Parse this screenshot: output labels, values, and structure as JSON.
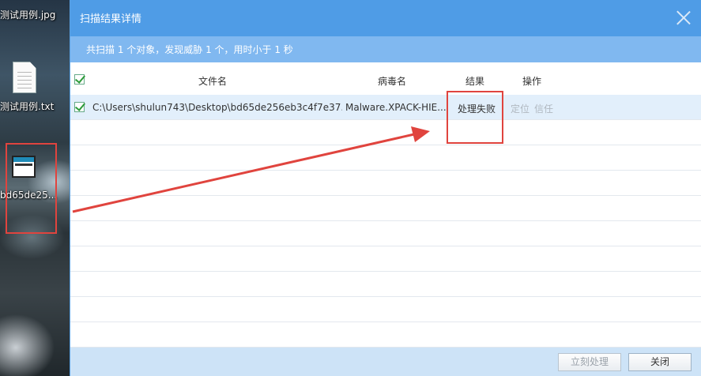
{
  "desktop": {
    "icons": [
      {
        "label": "测试用例.jpg"
      },
      {
        "label": "测试用例.txt"
      },
      {
        "label": "bd65de25..."
      }
    ]
  },
  "dialog": {
    "title": "扫描结果详情",
    "summary": "共扫描 1 个对象，发现威胁 1 个，用时小于 1 秒",
    "columns": {
      "filename": "文件名",
      "virus": "病毒名",
      "result": "结果",
      "action": "操作"
    },
    "rows": [
      {
        "checked": true,
        "filename": "C:\\Users\\shulun743\\Desktop\\bd65de256eb3c4f7e37...",
        "virus": "Malware.XPACK-HIE...",
        "result": "处理失败",
        "locate": "定位",
        "trust": "信任"
      }
    ],
    "buttons": {
      "process_now": "立刻处理",
      "close": "关闭"
    }
  },
  "annotation_color": "#e0443e"
}
